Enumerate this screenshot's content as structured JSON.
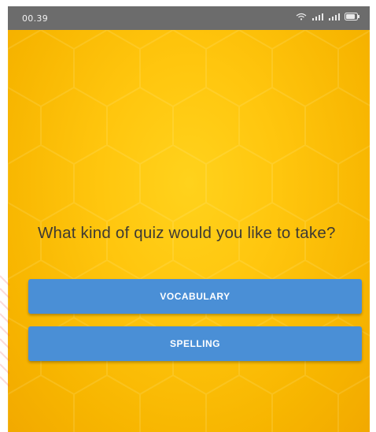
{
  "status_bar": {
    "time": "00.39",
    "icons": [
      "wifi-icon",
      "signal-icon",
      "signal-icon",
      "battery-icon"
    ]
  },
  "quiz": {
    "question": "What kind of quiz would you like to take?",
    "buttons": {
      "vocabulary": "VOCABULARY",
      "spelling": "SPELLING"
    }
  },
  "colors": {
    "background": "#ffc60e",
    "button": "#4a8fd6",
    "status_bar": "#6c6c6c",
    "question_text": "#3e3a33"
  }
}
